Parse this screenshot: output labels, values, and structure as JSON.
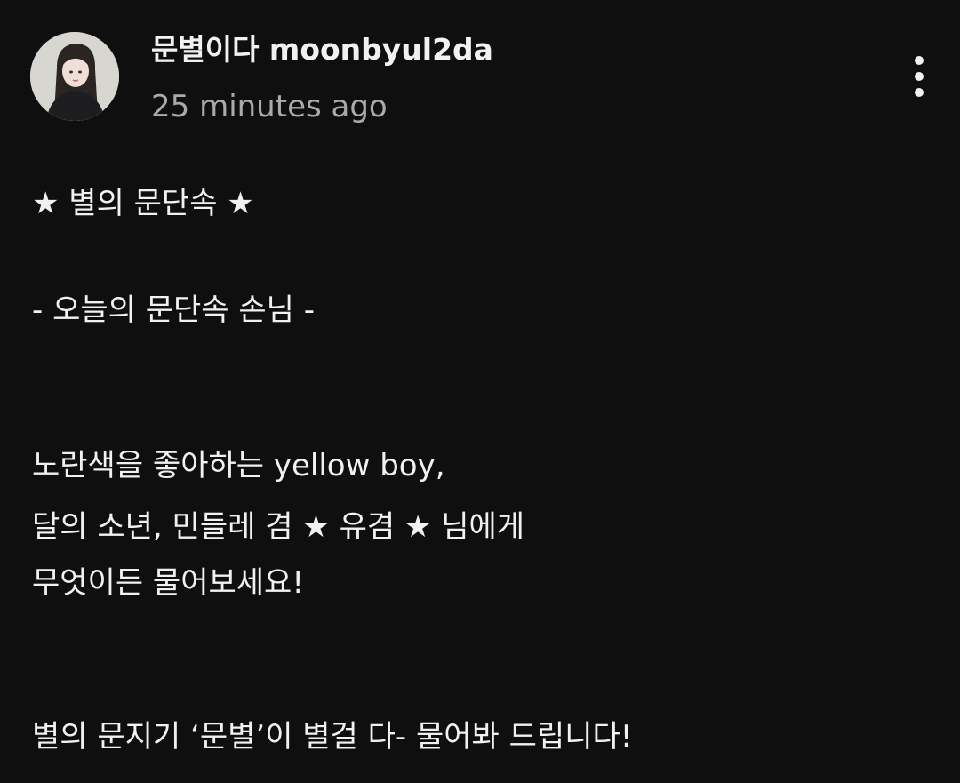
{
  "post": {
    "author": "문별이다 moonbyul2da",
    "time": "25 minutes ago",
    "more_icon": "more-vertical-icon",
    "avatar_icon": "avatar-photo",
    "lines": [
      "★ 별의 문단속 ★",
      "- 오늘의 문단속 손님 -",
      "노란색을 좋아하는 yellow boy,",
      "달의 소년, 민들레 겸 ★ 유겸 ★ 님에게",
      "무엇이든 물어보세요!",
      "별의 문지기 ‘문별’이 별걸 다- 물어봐 드립니다!"
    ]
  },
  "colors": {
    "background": "#0f0f0f",
    "text": "#f1f1f1",
    "secondary_text": "#aaaaaa"
  }
}
